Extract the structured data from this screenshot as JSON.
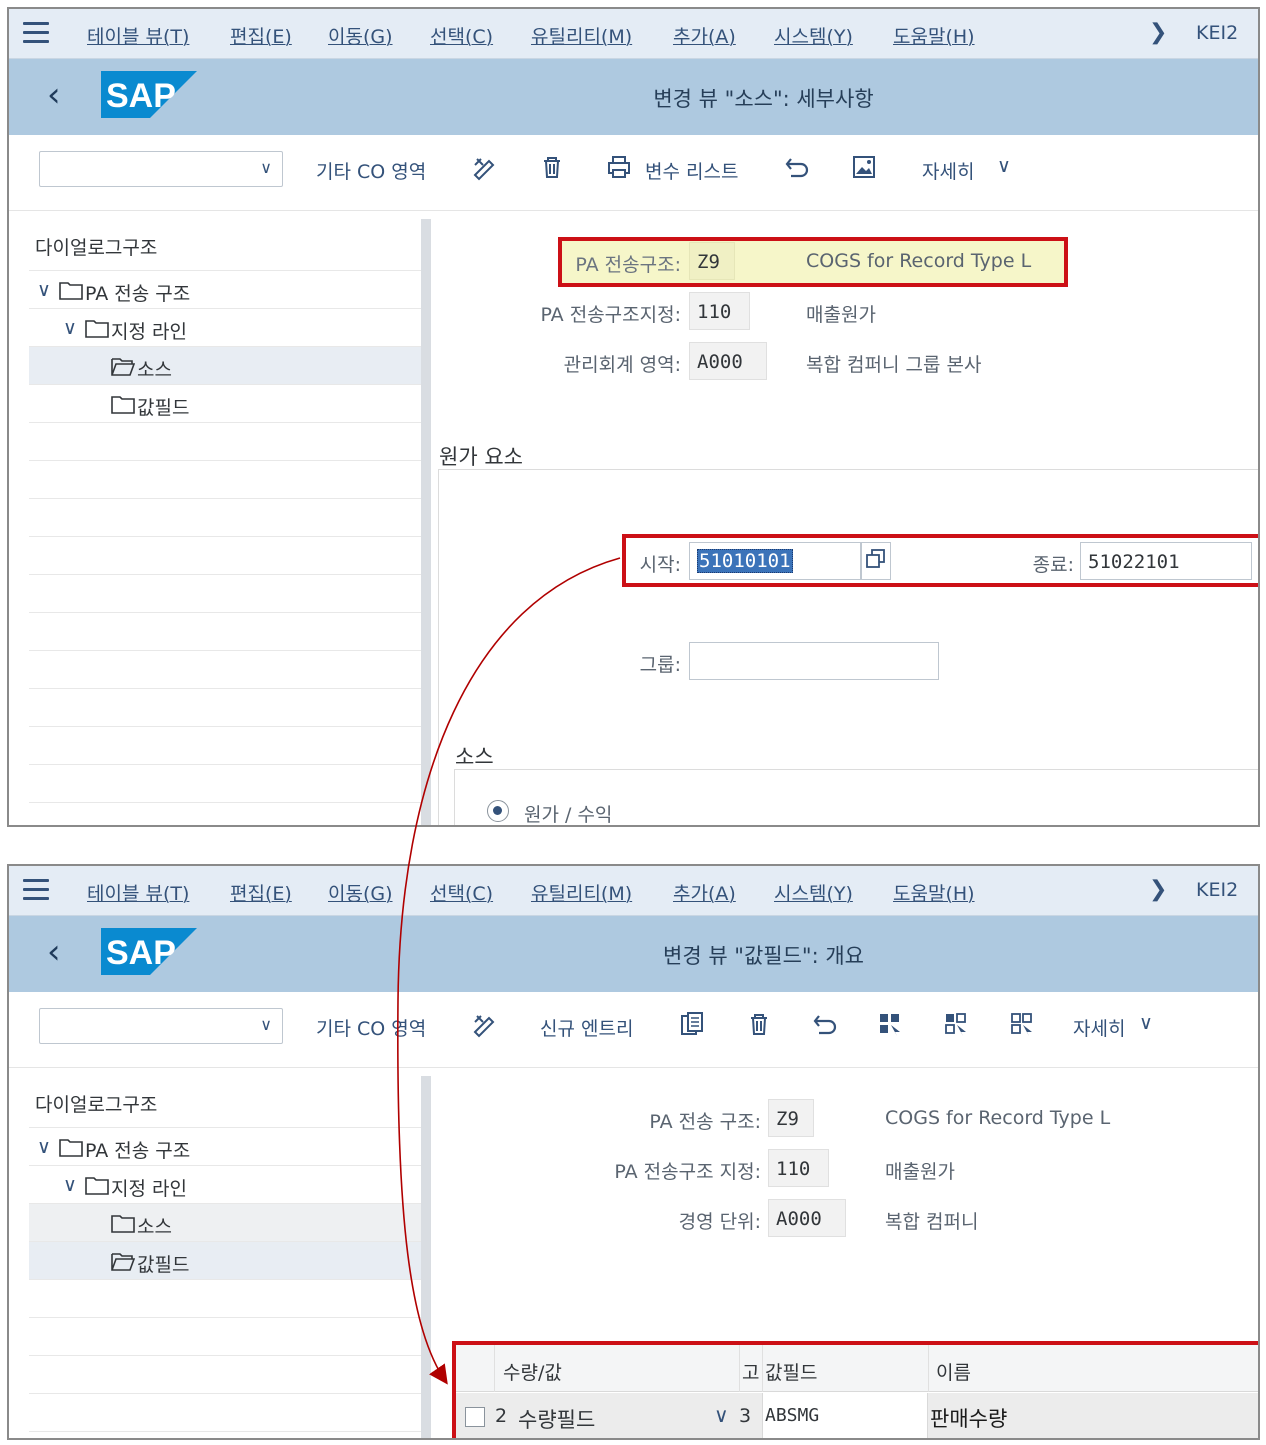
{
  "menu": {
    "items": [
      "테이블 뷰(T)",
      "편집(E)",
      "이동(G)",
      "선택(C)",
      "유틸리티(M)",
      "추가(A)",
      "시스템(Y)",
      "도움말(H)"
    ],
    "system": "KEI2"
  },
  "top": {
    "title": "변경 뷰 \"소스\": 세부사항",
    "toolbar": {
      "other_co": "기타 CO 영역",
      "var_list": "변수 리스트",
      "more": "자세히"
    },
    "tree": {
      "header": "다이얼로그구조",
      "items": [
        "PA 전송 구조",
        "지정 라인",
        "소스",
        "값필드"
      ]
    },
    "fields": {
      "pa_struct_label": "PA 전송구조:",
      "pa_struct_value": "Z9",
      "pa_struct_desc": "COGS for Record Type L",
      "assign_label": "PA 전송구조지정:",
      "assign_value": "110",
      "assign_desc": "매출원가",
      "ca_label": "관리회계 영역:",
      "ca_value": "A000",
      "ca_desc": "복합 컴퍼니 그룹 본사"
    },
    "cost_elements": {
      "section": "원가 요소",
      "from_label": "시작:",
      "from_value": "51010101",
      "to_label": "종료:",
      "to_value": "51022101",
      "group_label": "그룹:",
      "group_value": ""
    },
    "source": {
      "section": "소스",
      "radio_label": "원가 / 수익"
    }
  },
  "bottom": {
    "title": "변경 뷰 \"값필드\": 개요",
    "toolbar": {
      "other_co": "기타 CO 영역",
      "new_entry": "신규 엔트리",
      "more": "자세히"
    },
    "tree": {
      "header": "다이얼로그구조",
      "items": [
        "PA 전송 구조",
        "지정 라인",
        "소스",
        "값필드"
      ]
    },
    "fields": {
      "pa_struct_label": "PA 전송 구조:",
      "pa_struct_value": "Z9",
      "pa_struct_desc": "COGS for Record Type L",
      "assign_label": "PA 전송구조 지정:",
      "assign_value": "110",
      "assign_desc": "매출원가",
      "oc_label": "경영 단위:",
      "oc_value": "A000",
      "oc_desc": "복합 컴퍼니"
    },
    "grid": {
      "headers": [
        "수량/값",
        "고",
        "값필드",
        "이름"
      ],
      "row": {
        "num": "2",
        "type": "수량필드",
        "fixed": "3",
        "field": "ABSMG",
        "name": "판매수량"
      }
    }
  },
  "colors": {
    "highlight_box": "#cc1016",
    "header_bg": "#aec9e0",
    "menubar_bg": "#e4ecf5",
    "selection": "#3b73b9"
  }
}
